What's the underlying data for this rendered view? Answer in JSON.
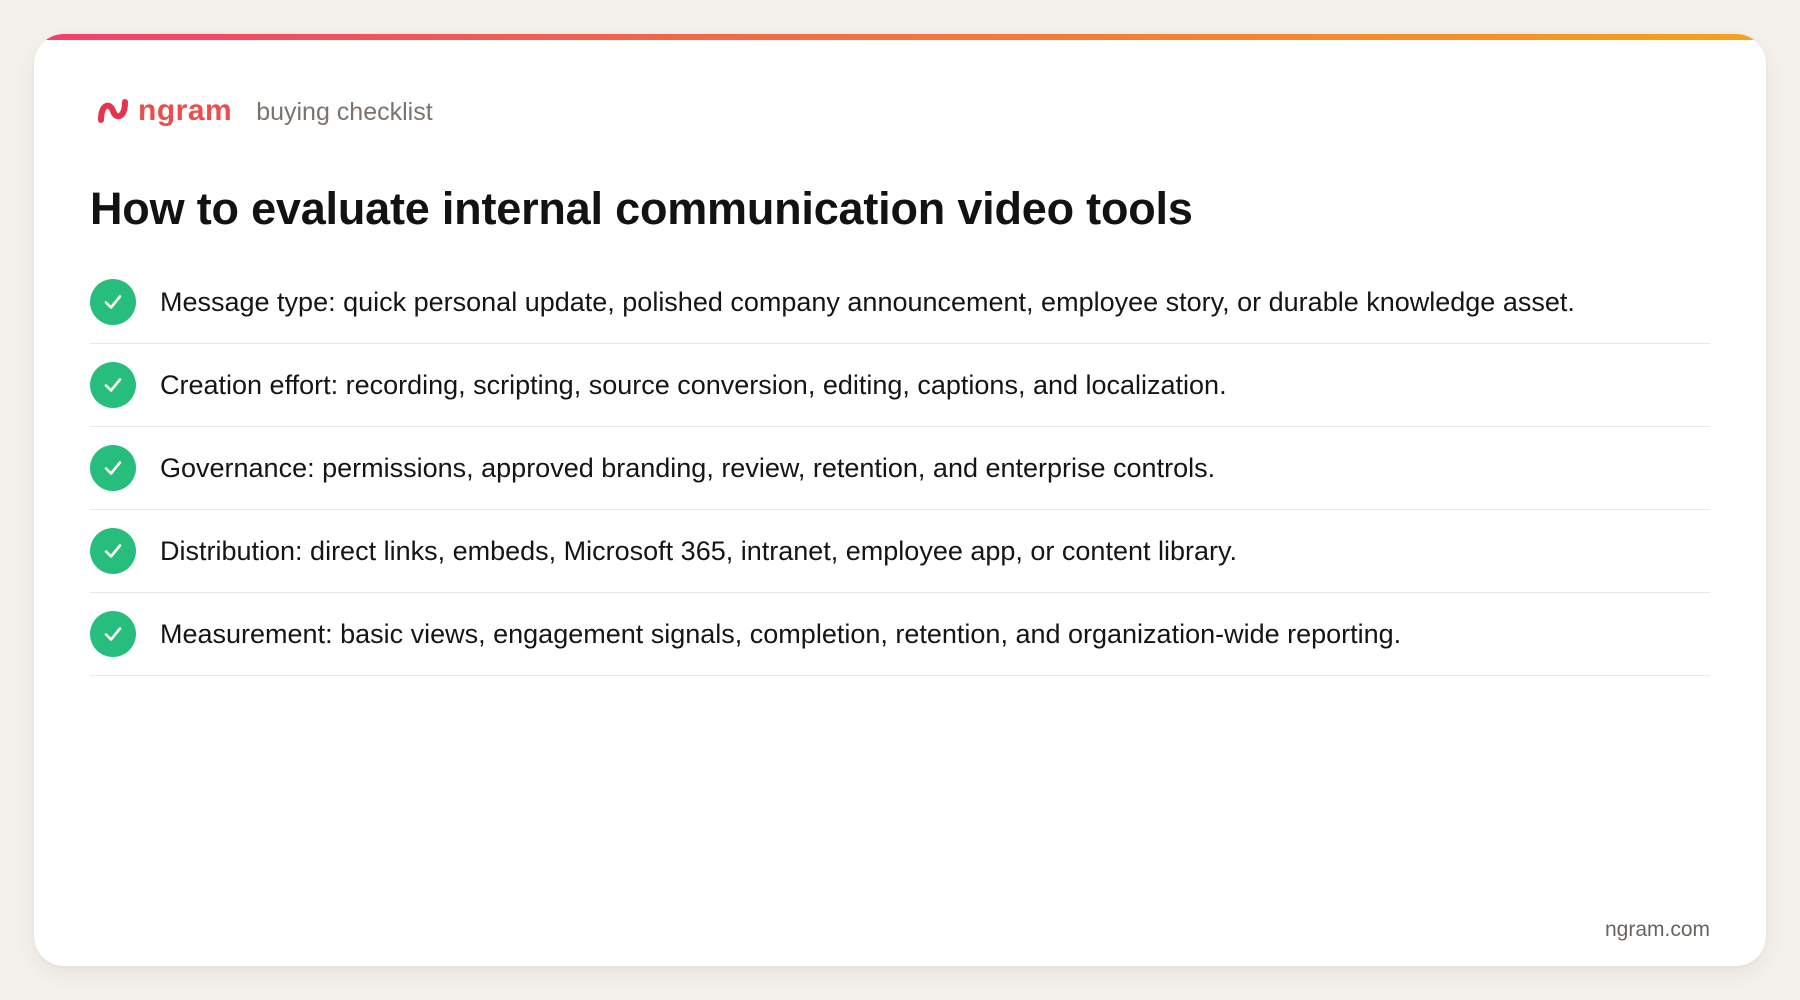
{
  "brand": {
    "name": "ngram",
    "tagline": "buying checklist",
    "logo_icon": "ngram-logo-icon",
    "color": "#ea4f4d"
  },
  "page": {
    "title": "How to evaluate internal communication video tools"
  },
  "checklist": {
    "icon": "check-icon",
    "icon_color": "#27be7d",
    "items": [
      {
        "text": "Message type: quick personal update, polished company announcement, employee story, or durable knowledge asset."
      },
      {
        "text": "Creation effort: recording, scripting, source conversion, editing, captions, and localization."
      },
      {
        "text": "Governance: permissions, approved branding, review, retention, and enterprise controls."
      },
      {
        "text": "Distribution: direct links, embeds, Microsoft 365, intranet, employee app, or content library."
      },
      {
        "text": "Measurement: basic views, engagement signals, completion, retention, and organization-wide reporting."
      }
    ]
  },
  "footer": {
    "url": "ngram.com"
  },
  "colors": {
    "background": "#f4f1ec",
    "card": "#ffffff",
    "accent_gradient": [
      "#f33f6c",
      "#f26e43",
      "#f6a11a"
    ]
  }
}
